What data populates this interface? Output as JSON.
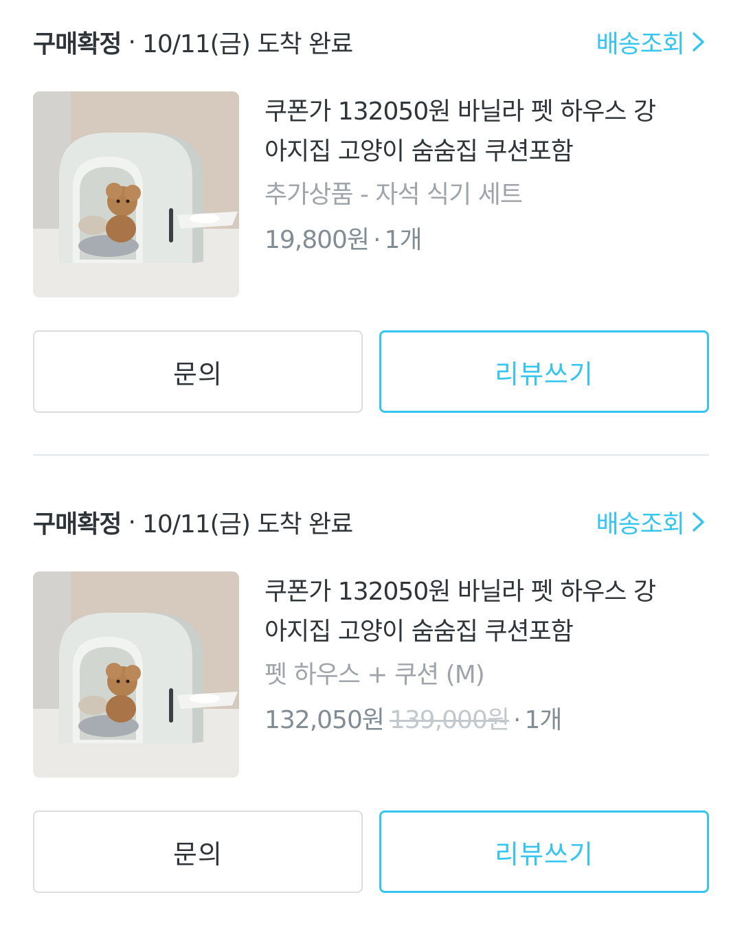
{
  "accent_color": "#35c5f0",
  "orders": [
    {
      "status": "구매확정",
      "separator": "·",
      "arrival": "10/11(금) 도착 완료",
      "track_label": "배송조회",
      "product_name_line1": "쿠폰가 132050원 바닐라 펫 하우스 강",
      "product_name_line2": "아지집 고양이 숨숨집 쿠션포함",
      "option": "추가상품 - 자석 식기 세트",
      "price": "19,800원",
      "original_price": "",
      "quantity": "1개",
      "inquiry_label": "문의",
      "review_label": "리뷰쓰기"
    },
    {
      "status": "구매확정",
      "separator": "·",
      "arrival": "10/11(금) 도착 완료",
      "track_label": "배송조회",
      "product_name_line1": "쿠폰가 132050원 바닐라 펫 하우스 강",
      "product_name_line2": "아지집 고양이 숨숨집 쿠션포함",
      "option": "펫 하우스 + 쿠션 (M)",
      "price": "132,050원",
      "original_price": "139,000원",
      "quantity": "1개",
      "inquiry_label": "문의",
      "review_label": "리뷰쓰기"
    }
  ]
}
